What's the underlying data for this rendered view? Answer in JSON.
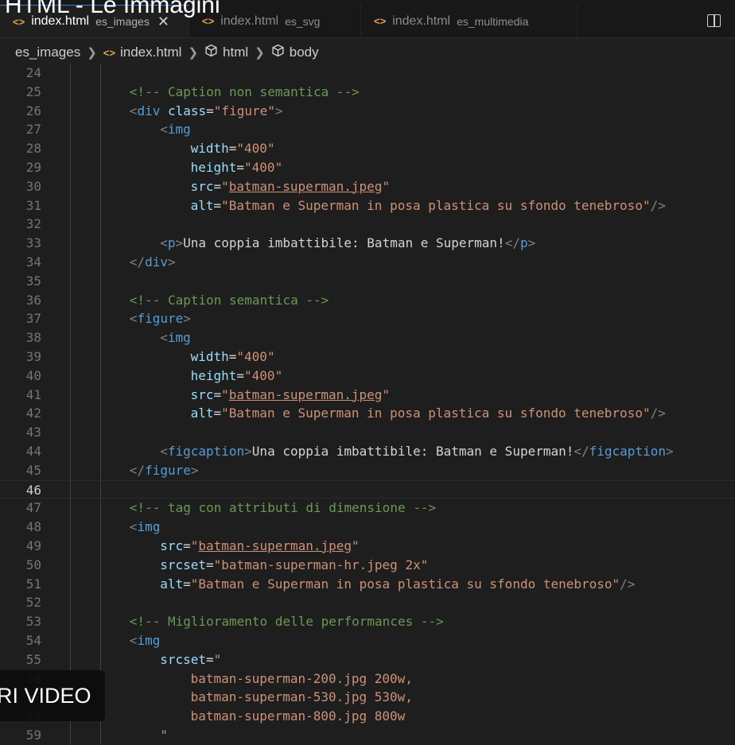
{
  "video": {
    "title": "HTML - Le Immagini",
    "badge": "RI VIDEO"
  },
  "tabs": [
    {
      "name": "index.html",
      "desc": "es_images",
      "active": true,
      "close": "✕"
    },
    {
      "name": "index.html",
      "desc": "es_svg",
      "active": false
    },
    {
      "name": "index.html",
      "desc": "es_multimedia",
      "active": false
    }
  ],
  "breadcrumb": [
    "es_images",
    "index.html",
    "html",
    "body"
  ],
  "editor": {
    "current_line": 46,
    "lines": [
      {
        "n": "24",
        "indent": 0,
        "tokens": []
      },
      {
        "n": "25",
        "indent": 2,
        "tokens": [
          {
            "t": "com",
            "v": "<!-- Caption non semantica -->"
          }
        ]
      },
      {
        "n": "26",
        "indent": 2,
        "tokens": [
          {
            "t": "br",
            "v": "<"
          },
          {
            "t": "tag",
            "v": "div"
          },
          {
            "t": "txt",
            "v": " "
          },
          {
            "t": "attr",
            "v": "class"
          },
          {
            "t": "txt",
            "v": "="
          },
          {
            "t": "str",
            "v": "\"figure\""
          },
          {
            "t": "br",
            "v": ">"
          }
        ]
      },
      {
        "n": "27",
        "indent": 3,
        "tokens": [
          {
            "t": "br",
            "v": "<"
          },
          {
            "t": "tag",
            "v": "img"
          }
        ]
      },
      {
        "n": "28",
        "indent": 4,
        "tokens": [
          {
            "t": "attr",
            "v": "width"
          },
          {
            "t": "txt",
            "v": "="
          },
          {
            "t": "str",
            "v": "\"400\""
          }
        ]
      },
      {
        "n": "29",
        "indent": 4,
        "tokens": [
          {
            "t": "attr",
            "v": "height"
          },
          {
            "t": "txt",
            "v": "="
          },
          {
            "t": "str",
            "v": "\"400\""
          }
        ]
      },
      {
        "n": "30",
        "indent": 4,
        "tokens": [
          {
            "t": "attr",
            "v": "src"
          },
          {
            "t": "txt",
            "v": "="
          },
          {
            "t": "str",
            "v": "\""
          },
          {
            "t": "url",
            "v": "batman-superman.jpeg"
          },
          {
            "t": "str",
            "v": "\""
          }
        ]
      },
      {
        "n": "31",
        "indent": 4,
        "tokens": [
          {
            "t": "attr",
            "v": "alt"
          },
          {
            "t": "txt",
            "v": "="
          },
          {
            "t": "str",
            "v": "\"Batman e Superman in posa plastica su sfondo tenebroso\""
          },
          {
            "t": "br",
            "v": "/>"
          }
        ]
      },
      {
        "n": "32",
        "indent": 0,
        "tokens": []
      },
      {
        "n": "33",
        "indent": 3,
        "tokens": [
          {
            "t": "br",
            "v": "<"
          },
          {
            "t": "tag",
            "v": "p"
          },
          {
            "t": "br",
            "v": ">"
          },
          {
            "t": "txt",
            "v": "Una coppia imbattibile: Batman e Superman!"
          },
          {
            "t": "br",
            "v": "</"
          },
          {
            "t": "tag",
            "v": "p"
          },
          {
            "t": "br",
            "v": ">"
          }
        ]
      },
      {
        "n": "34",
        "indent": 2,
        "tokens": [
          {
            "t": "br",
            "v": "</"
          },
          {
            "t": "tag",
            "v": "div"
          },
          {
            "t": "br",
            "v": ">"
          }
        ]
      },
      {
        "n": "35",
        "indent": 0,
        "tokens": []
      },
      {
        "n": "36",
        "indent": 2,
        "tokens": [
          {
            "t": "com",
            "v": "<!-- Caption semantica -->"
          }
        ]
      },
      {
        "n": "37",
        "indent": 2,
        "tokens": [
          {
            "t": "br",
            "v": "<"
          },
          {
            "t": "tag",
            "v": "figure"
          },
          {
            "t": "br",
            "v": ">"
          }
        ]
      },
      {
        "n": "38",
        "indent": 3,
        "tokens": [
          {
            "t": "br",
            "v": "<"
          },
          {
            "t": "tag",
            "v": "img"
          }
        ]
      },
      {
        "n": "39",
        "indent": 4,
        "tokens": [
          {
            "t": "attr",
            "v": "width"
          },
          {
            "t": "txt",
            "v": "="
          },
          {
            "t": "str",
            "v": "\"400\""
          }
        ]
      },
      {
        "n": "40",
        "indent": 4,
        "tokens": [
          {
            "t": "attr",
            "v": "height"
          },
          {
            "t": "txt",
            "v": "="
          },
          {
            "t": "str",
            "v": "\"400\""
          }
        ]
      },
      {
        "n": "41",
        "indent": 4,
        "tokens": [
          {
            "t": "attr",
            "v": "src"
          },
          {
            "t": "txt",
            "v": "="
          },
          {
            "t": "str",
            "v": "\""
          },
          {
            "t": "url",
            "v": "batman-superman.jpeg"
          },
          {
            "t": "str",
            "v": "\""
          }
        ]
      },
      {
        "n": "42",
        "indent": 4,
        "tokens": [
          {
            "t": "attr",
            "v": "alt"
          },
          {
            "t": "txt",
            "v": "="
          },
          {
            "t": "str",
            "v": "\"Batman e Superman in posa plastica su sfondo tenebroso\""
          },
          {
            "t": "br",
            "v": "/>"
          }
        ]
      },
      {
        "n": "43",
        "indent": 0,
        "tokens": []
      },
      {
        "n": "44",
        "indent": 3,
        "tokens": [
          {
            "t": "br",
            "v": "<"
          },
          {
            "t": "tag",
            "v": "figcaption"
          },
          {
            "t": "br",
            "v": ">"
          },
          {
            "t": "txt",
            "v": "Una coppia imbattibile: Batman e Superman!"
          },
          {
            "t": "br",
            "v": "</"
          },
          {
            "t": "tag",
            "v": "figcaption"
          },
          {
            "t": "br",
            "v": ">"
          }
        ]
      },
      {
        "n": "45",
        "indent": 2,
        "tokens": [
          {
            "t": "br",
            "v": "</"
          },
          {
            "t": "tag",
            "v": "figure"
          },
          {
            "t": "br",
            "v": ">"
          }
        ]
      },
      {
        "n": "46",
        "indent": 0,
        "tokens": []
      },
      {
        "n": "47",
        "indent": 2,
        "tokens": [
          {
            "t": "com",
            "v": "<!-- tag con attributi di dimensione -->"
          }
        ]
      },
      {
        "n": "48",
        "indent": 2,
        "tokens": [
          {
            "t": "br",
            "v": "<"
          },
          {
            "t": "tag",
            "v": "img"
          }
        ]
      },
      {
        "n": "49",
        "indent": 3,
        "tokens": [
          {
            "t": "attr",
            "v": "src"
          },
          {
            "t": "txt",
            "v": "="
          },
          {
            "t": "str",
            "v": "\""
          },
          {
            "t": "url",
            "v": "batman-superman.jpeg"
          },
          {
            "t": "str",
            "v": "\""
          }
        ]
      },
      {
        "n": "50",
        "indent": 3,
        "tokens": [
          {
            "t": "attr",
            "v": "srcset"
          },
          {
            "t": "txt",
            "v": "="
          },
          {
            "t": "str",
            "v": "\"batman-superman-hr.jpeg 2x\""
          }
        ]
      },
      {
        "n": "51",
        "indent": 3,
        "tokens": [
          {
            "t": "attr",
            "v": "alt"
          },
          {
            "t": "txt",
            "v": "="
          },
          {
            "t": "str",
            "v": "\"Batman e Superman in posa plastica su sfondo tenebroso\""
          },
          {
            "t": "br",
            "v": "/>"
          }
        ]
      },
      {
        "n": "52",
        "indent": 0,
        "tokens": []
      },
      {
        "n": "53",
        "indent": 2,
        "tokens": [
          {
            "t": "com",
            "v": "<!-- Miglioramento delle performances -->"
          }
        ]
      },
      {
        "n": "54",
        "indent": 2,
        "tokens": [
          {
            "t": "br",
            "v": "<"
          },
          {
            "t": "tag",
            "v": "img"
          }
        ]
      },
      {
        "n": "55",
        "indent": 3,
        "tokens": [
          {
            "t": "attr",
            "v": "srcset"
          },
          {
            "t": "txt",
            "v": "="
          },
          {
            "t": "str",
            "v": "\""
          }
        ]
      },
      {
        "n": "56",
        "indent": 4,
        "tokens": [
          {
            "t": "str",
            "v": "batman-superman-200.jpg 200w,"
          }
        ]
      },
      {
        "n": "57",
        "indent": 4,
        "tokens": [
          {
            "t": "str",
            "v": "batman-superman-530.jpg 530w,"
          }
        ]
      },
      {
        "n": "58",
        "indent": 4,
        "tokens": [
          {
            "t": "str",
            "v": "batman-superman-800.jpg 800w"
          }
        ]
      },
      {
        "n": "59",
        "indent": 3,
        "tokens": [
          {
            "t": "str",
            "v": "\""
          }
        ]
      }
    ]
  }
}
